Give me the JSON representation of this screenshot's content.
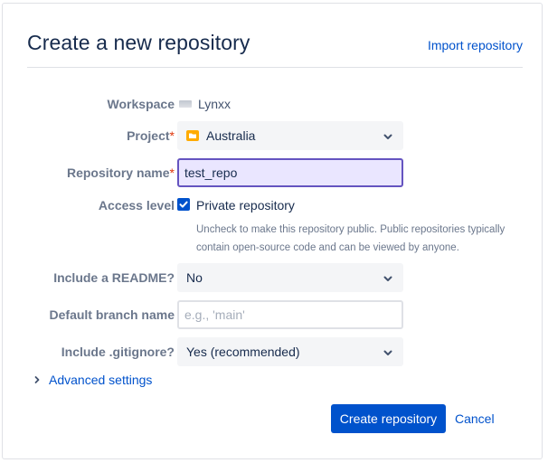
{
  "header": {
    "title": "Create a new repository",
    "import_link": "Import repository"
  },
  "form": {
    "workspace": {
      "label": "Workspace",
      "value": "Lynxx"
    },
    "project": {
      "label": "Project",
      "required_mark": "*",
      "value": "Australia",
      "icon": "folder-icon"
    },
    "repository_name": {
      "label": "Repository name",
      "required_mark": "*",
      "value": "test_repo"
    },
    "access_level": {
      "label": "Access level",
      "checkbox_label": "Private repository",
      "checked": true,
      "help": "Uncheck to make this repository public. Public repositories typically contain open-source code and can be viewed by anyone."
    },
    "readme": {
      "label": "Include a README?",
      "value": "No"
    },
    "default_branch": {
      "label": "Default branch name",
      "value": "",
      "placeholder": "e.g., 'main'"
    },
    "gitignore": {
      "label": "Include .gitignore?",
      "value": "Yes (recommended)"
    }
  },
  "advanced_settings": "Advanced settings",
  "actions": {
    "create": "Create repository",
    "cancel": "Cancel"
  },
  "colors": {
    "primary": "#0052cc",
    "required": "#de350b",
    "focus_border": "#6554c0",
    "focus_bg": "#eae6ff",
    "folder": "#ffab00"
  }
}
